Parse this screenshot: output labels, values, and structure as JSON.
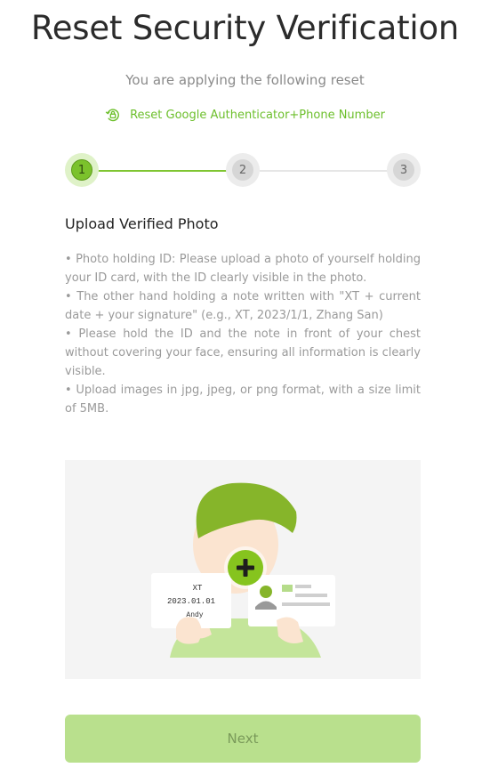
{
  "page": {
    "title": "Reset Security Verification",
    "subtitle": "You are applying the following reset",
    "reset_type": {
      "icon": "lock-reset-icon",
      "label": "Reset Google Authenticator+Phone Number",
      "color": "#6cbf2b"
    }
  },
  "stepper": {
    "current_step": 1,
    "steps": [
      {
        "number": "1",
        "state": "active"
      },
      {
        "number": "2",
        "state": "pending"
      },
      {
        "number": "3",
        "state": "pending"
      }
    ],
    "active_color": "#7bc22c",
    "inactive_color": "#d6d6d6"
  },
  "upload": {
    "section_title": "Upload Verified Photo",
    "instructions": [
      "• Photo holding ID: Please upload a photo of yourself holding your ID card, with the ID clearly visible in the photo.",
      "• The other hand holding a note written with \"XT + current date + your signature\" (e.g., XT, 2023/1/1, Zhang San)",
      "• Please hold the ID and the note in front of your chest without covering your face, ensuring all information is clearly visible.",
      "• Upload images in jpg, jpeg, or png format, with a size limit of 5MB."
    ],
    "example_note_lines": [
      "XT",
      "2023.01.01",
      "Andy"
    ],
    "add_icon": "plus-icon"
  },
  "actions": {
    "next_label": "Next",
    "next_color": "#b9e08d"
  }
}
